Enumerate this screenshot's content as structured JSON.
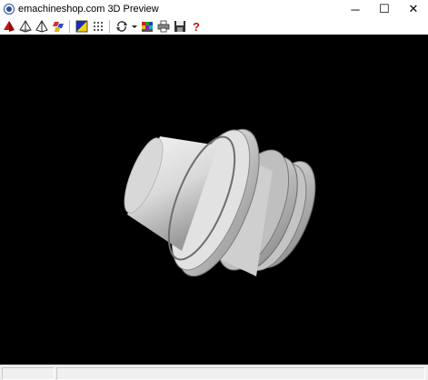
{
  "window": {
    "title": "emachineshop.com 3D Preview",
    "icon": "emachineshop-globe-icon",
    "minimize_glyph": "─",
    "maximize_glyph": "☐",
    "close_glyph": "✕"
  },
  "toolbar": {
    "buttons": [
      {
        "name": "shaded-view-button",
        "icon": "red-pyramid-icon"
      },
      {
        "name": "wireframe-view-button",
        "icon": "wireframe-pyramid-icon"
      },
      {
        "name": "hidden-line-view-button",
        "icon": "outline-pyramid-icon"
      },
      {
        "name": "multi-view-button",
        "icon": "color-blocks-icon"
      },
      {
        "name": "color-button",
        "icon": "blue-yellow-triangle-icon"
      },
      {
        "name": "grid-points-button",
        "icon": "dot-grid-icon"
      },
      {
        "name": "rotate-button",
        "icon": "rotate-arrows-icon"
      },
      {
        "name": "rotate-dropdown-button",
        "icon": "dropdown-arrow-icon"
      },
      {
        "name": "palette-button",
        "icon": "color-palette-icon"
      },
      {
        "name": "print-button",
        "icon": "printer-icon"
      },
      {
        "name": "save-button",
        "icon": "floppy-disk-icon"
      },
      {
        "name": "help-button",
        "icon": "help-question-icon",
        "glyph": "?"
      }
    ]
  },
  "viewport": {
    "background": "#000000",
    "model": "turned part"
  },
  "colors": {
    "accent_red": "#cc1111",
    "help_red": "#d01010",
    "model_light": "#e6e6e6",
    "model_shadow": "#7a7a7a"
  }
}
